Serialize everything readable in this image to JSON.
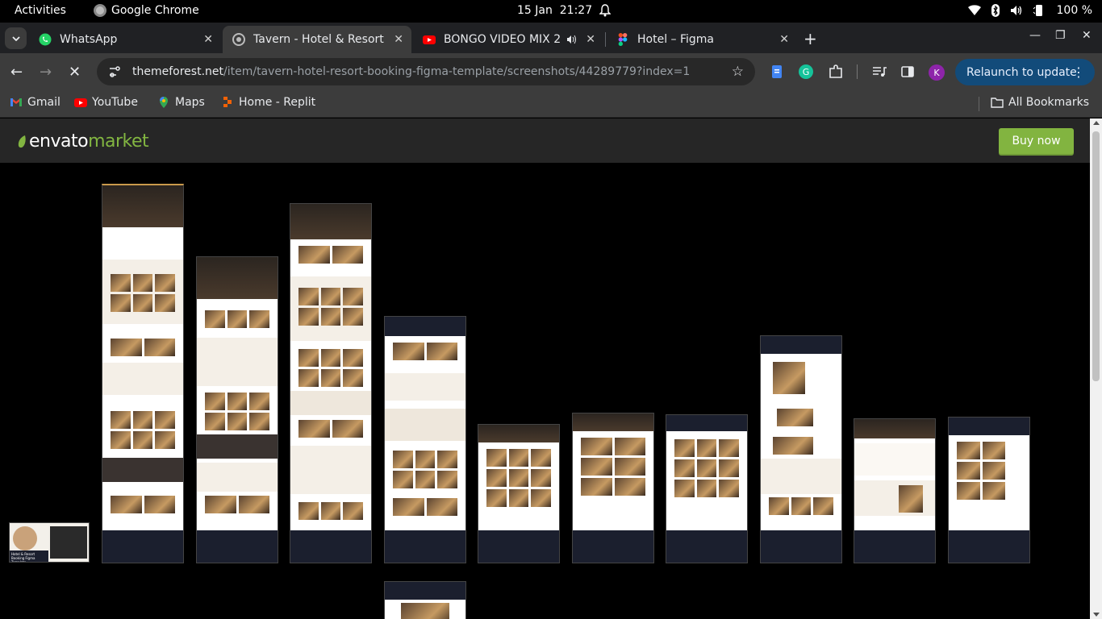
{
  "system_bar": {
    "activities": "Activities",
    "app_name": "Google Chrome",
    "date": "15 Jan",
    "time": "21:27",
    "battery": "100 %"
  },
  "tabs": [
    {
      "label": "WhatsApp",
      "icon": "whatsapp-icon",
      "active": false
    },
    {
      "label": "Tavern - Hotel & Resort B",
      "icon": "envato-icon",
      "active": true
    },
    {
      "label": "BONGO VIDEO MIX 2",
      "icon": "youtube-icon",
      "active": false,
      "audio": true
    },
    {
      "label": "Hotel – Figma",
      "icon": "figma-icon",
      "active": false
    }
  ],
  "omnibox": {
    "host": "themeforest.net",
    "path": "/item/tavern-hotel-resort-booking-figma-template/screenshots/44289779?index=1"
  },
  "toolbar": {
    "relaunch_label": "Relaunch to update",
    "profile_initial": "K"
  },
  "bookmarks": [
    {
      "label": "Gmail",
      "icon": "gmail-icon"
    },
    {
      "label": "YouTube",
      "icon": "youtube-icon"
    },
    {
      "label": "Maps",
      "icon": "maps-icon"
    },
    {
      "label": "Home - Replit",
      "icon": "replit-icon"
    }
  ],
  "all_bookmarks": "All Bookmarks",
  "envato": {
    "logo_primary": "envato",
    "logo_secondary": "market",
    "buy_label": "Buy now",
    "brand_color": "#82b440"
  },
  "thumbnails": {
    "count": 12,
    "cover_caption": "Hotel & Resort Booking Figma Template"
  }
}
